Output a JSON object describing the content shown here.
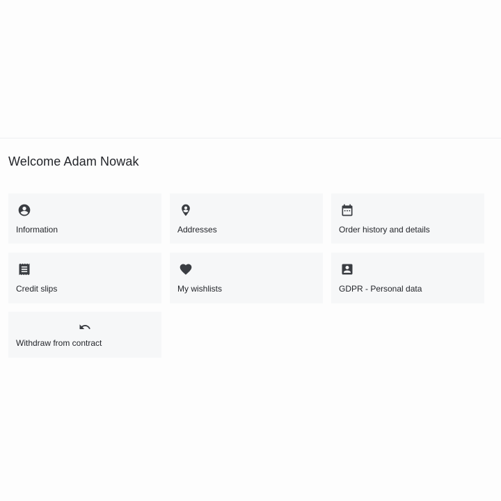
{
  "welcome": {
    "title": "Welcome Adam Nowak"
  },
  "tiles": [
    {
      "label": "Information",
      "icon": "account-circle-icon"
    },
    {
      "label": "Addresses",
      "icon": "location-pin-icon"
    },
    {
      "label": "Order history and details",
      "icon": "calendar-icon"
    },
    {
      "label": "Credit slips",
      "icon": "receipt-icon"
    },
    {
      "label": "My wishlists",
      "icon": "heart-icon"
    },
    {
      "label": "GDPR - Personal data",
      "icon": "account-box-icon"
    },
    {
      "label": "Withdraw from contract",
      "icon": "undo-icon"
    }
  ],
  "colors": {
    "tile_bg": "#f6f7f8",
    "icon": "#3a3d42",
    "text": "#23252a"
  }
}
